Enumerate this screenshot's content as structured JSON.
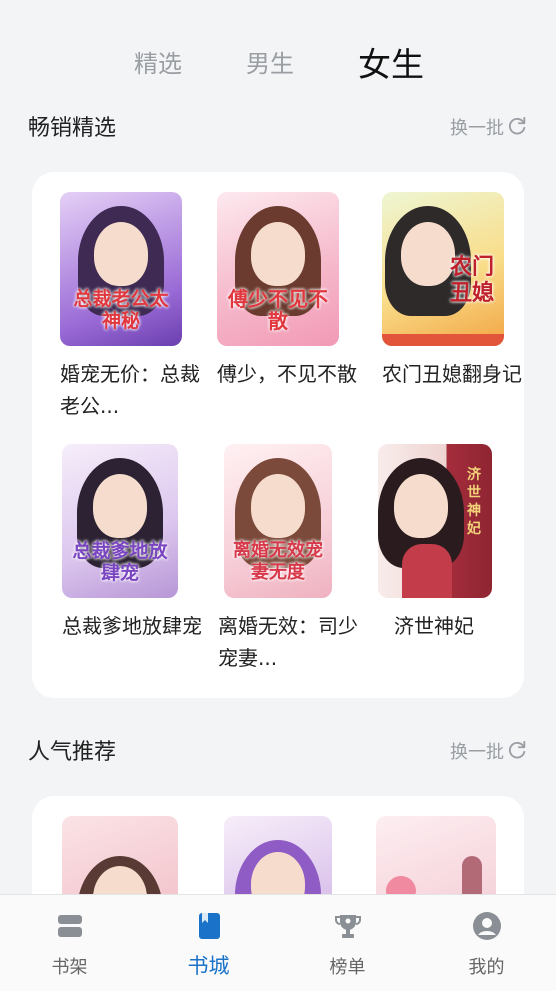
{
  "top_tabs": [
    {
      "label": "精选",
      "active": false
    },
    {
      "label": "男生",
      "active": false
    },
    {
      "label": "女生",
      "active": true
    }
  ],
  "section_bestsellers": {
    "title": "畅销精选",
    "action": "换一批",
    "books": [
      {
        "title": "婚宠无价：总裁老公...",
        "cover_text": "总裁老公太神秘",
        "cover_colors": [
          "#d9b7ef",
          "#7a4bc2"
        ]
      },
      {
        "title": "傅少，不见不散",
        "cover_text": "傅少不见不散",
        "cover_colors": [
          "#fbdbe4",
          "#f3a8c0"
        ]
      },
      {
        "title": "农门丑媳翻身记",
        "cover_text": "农门丑媳",
        "cover_colors": [
          "#e6f1c4",
          "#f6c85a"
        ]
      },
      {
        "title": "总裁爹地放肆宠",
        "cover_text": "总裁爹地放肆宠",
        "cover_colors": [
          "#f0e4f7",
          "#b99bd8"
        ]
      },
      {
        "title": "离婚无效：司少宠妻...",
        "cover_text": "离婚无效宠妻无度",
        "cover_colors": [
          "#fbe6ea",
          "#f4c6d0"
        ]
      },
      {
        "title": "济世神妃",
        "cover_text": "济世神妃",
        "cover_colors": [
          "#f3e3e1",
          "#b23b48"
        ]
      }
    ]
  },
  "section_popular": {
    "title": "人气推荐",
    "action": "换一批",
    "books": [
      {
        "cover_colors": [
          "#f6d8dc",
          "#e8a7b1"
        ]
      },
      {
        "cover_colors": [
          "#f1e3f6",
          "#a37cc9"
        ]
      },
      {
        "cover_colors": [
          "#fbe7ec",
          "#e7b3bf"
        ]
      }
    ]
  },
  "bottom_nav": [
    {
      "label": "书架",
      "icon": "bookshelf-icon",
      "active": false
    },
    {
      "label": "书城",
      "icon": "bookstore-icon",
      "active": true
    },
    {
      "label": "榜单",
      "icon": "trophy-icon",
      "active": false
    },
    {
      "label": "我的",
      "icon": "profile-icon",
      "active": false
    }
  ],
  "colors": {
    "accent": "#1a73c8",
    "muted": "#9a9ea3",
    "background": "#f2f4f6"
  }
}
